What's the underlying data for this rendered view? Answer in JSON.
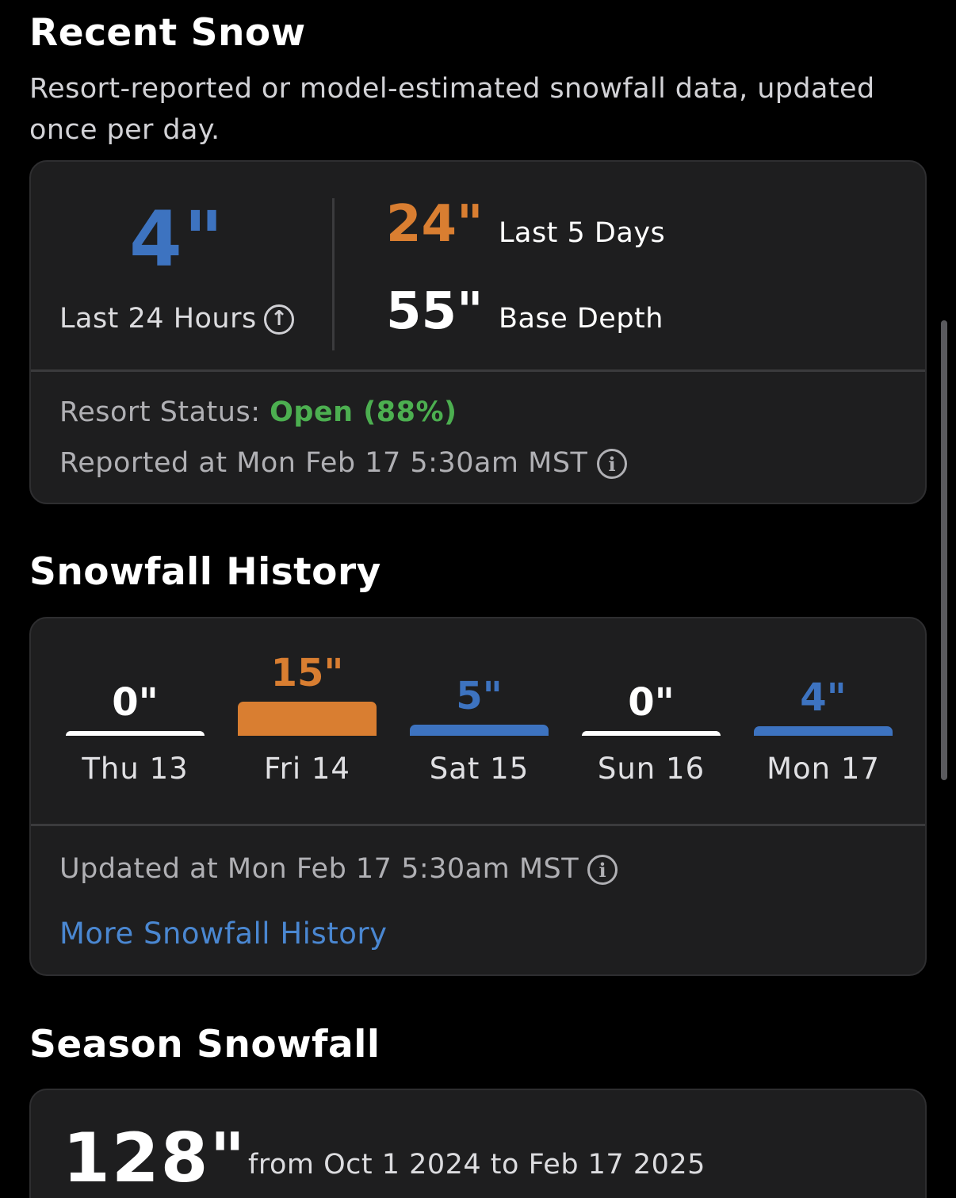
{
  "colors": {
    "blue": "#3d73c0",
    "orange": "#d97e31",
    "green": "#4caf50",
    "white": "#ffffff",
    "link": "#4a87d1"
  },
  "recent_snow": {
    "title": "Recent Snow",
    "subtitle": "Resort-reported or model-estimated snowfall data, updated once per day.",
    "last24_value": "4\"",
    "last24_label": "Last 24 Hours",
    "last24_icon": "arrow-up-circle-icon",
    "last5_value": "24\"",
    "last5_label": "Last 5 Days",
    "base_value": "55\"",
    "base_label": "Base Depth",
    "status_label": "Resort Status:",
    "status_value": "Open (88%)",
    "reported": "Reported at Mon Feb 17 5:30am MST",
    "info_icon": "info-icon"
  },
  "history": {
    "title": "Snowfall History",
    "days": [
      {
        "value": "0\"",
        "label": "Thu 13",
        "inches": 0,
        "color": "#ffffff"
      },
      {
        "value": "15\"",
        "label": "Fri 14",
        "inches": 15,
        "color": "#d97e31"
      },
      {
        "value": "5\"",
        "label": "Sat 15",
        "inches": 5,
        "color": "#3d73c0"
      },
      {
        "value": "0\"",
        "label": "Sun 16",
        "inches": 0,
        "color": "#ffffff"
      },
      {
        "value": "4\"",
        "label": "Mon 17",
        "inches": 4,
        "color": "#3d73c0"
      }
    ],
    "updated": "Updated at Mon Feb 17 5:30am MST",
    "more_link": "More Snowfall History"
  },
  "season": {
    "title": "Season Snowfall",
    "value": "128\"",
    "range": "from Oct 1 2024 to Feb 17 2025"
  }
}
